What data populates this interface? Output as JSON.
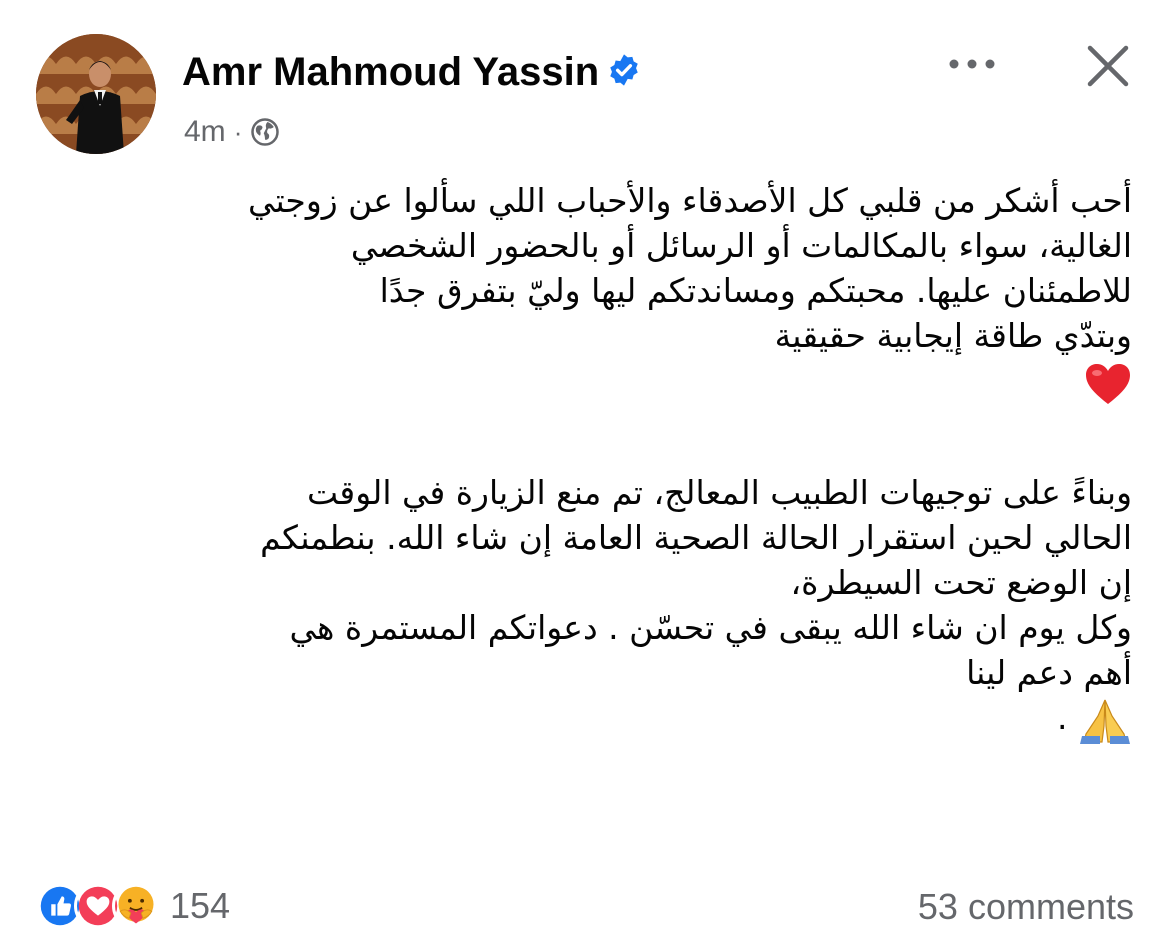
{
  "post": {
    "author_name": "Amr Mahmoud Yassin",
    "time": "4m",
    "separator": "·",
    "audience_icon": "globe-icon",
    "verified_icon": "verified-badge-icon",
    "more_icon": "more-horizontal-icon",
    "close_icon": "close-icon",
    "paragraph1": [
      "أحب أشكر من قلبي كل الأصدقاء والأحباب اللي سألوا عن زوجتي",
      "الغالية، سواء بالمكالمات أو الرسائل أو بالحضور الشخصي",
      "للاطمئنان عليها. محبتكم ومساندتكم  ليها وليّ بتفرق جدًا",
      "وبتدّي طاقة إيجابية حقيقية"
    ],
    "heart_emoji": "red-heart-icon",
    "paragraph2": [
      "وبناءً على توجيهات الطبيب المعالج، تم منع الزيارة في الوقت",
      "الحالي لحين استقرار الحالة الصحية العامة إن شاء الله. بنطمنكم",
      "إن الوضع تحت السيطرة،",
      "وكل يوم ان شاء الله  يبقى في تحسّن . دعواتكم المستمرة هي",
      "أهم دعم لينا"
    ],
    "final_line_dot": ".",
    "pray_emoji": "folded-hands-icon"
  },
  "footer": {
    "reaction_icons": [
      "like-icon",
      "love-icon",
      "care-icon"
    ],
    "reaction_count": "154",
    "comments_label": "53 comments"
  },
  "colors": {
    "facebook_blue": "#1877f2",
    "love_red": "#f33e58",
    "secondary_text": "#65676b",
    "care_yellow": "#f7b125"
  }
}
